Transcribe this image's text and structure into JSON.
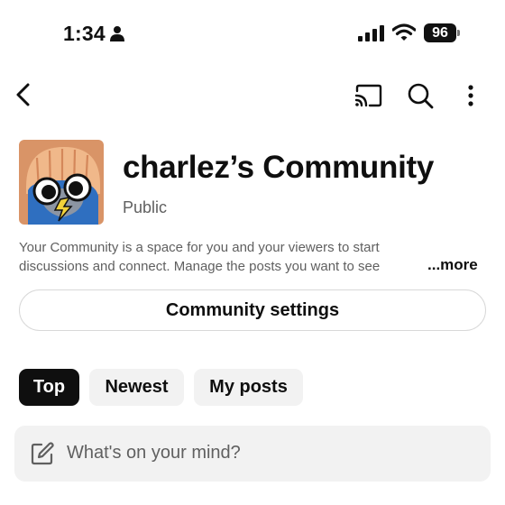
{
  "status_bar": {
    "time": "1:34",
    "battery": "96",
    "icons": [
      "person-icon",
      "cellular-signal-icon",
      "wifi-icon",
      "battery-icon"
    ]
  },
  "app_bar": {
    "icons": [
      "back-arrow-icon",
      "cast-icon",
      "search-icon",
      "more-vertical-icon"
    ]
  },
  "community": {
    "title": "charlez’s Community",
    "visibility": "Public",
    "description": "Your Community is a space for you and your viewers to start discussions and connect. Manage the posts you want to see",
    "more_label": "...more",
    "settings_label": "Community settings"
  },
  "filters": {
    "chips": [
      {
        "label": "Top",
        "selected": true
      },
      {
        "label": "Newest",
        "selected": false
      },
      {
        "label": "My posts",
        "selected": false
      }
    ]
  },
  "composer": {
    "placeholder": "What's on your mind?"
  },
  "colors": {
    "text_primary": "#0f0f0f",
    "text_secondary": "#606060",
    "chip_selected_bg": "#0f0f0f",
    "chip_bg": "#f2f2f2"
  }
}
